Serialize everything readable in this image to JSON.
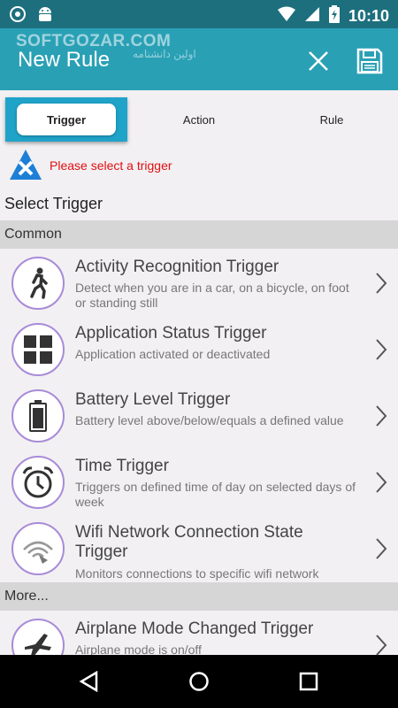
{
  "status_bar": {
    "time": "10:10"
  },
  "watermark": {
    "text": "SOFTGOZAR.COM",
    "subtext": "اولین دانشنامه"
  },
  "app_bar": {
    "title": "New Rule"
  },
  "tabs": [
    {
      "label": "Trigger"
    },
    {
      "label": "Action"
    },
    {
      "label": "Rule"
    }
  ],
  "warning": {
    "text": "Please select a trigger"
  },
  "section_title": "Select Trigger",
  "groups": {
    "common": "Common",
    "more": "More..."
  },
  "items": [
    {
      "title": "Activity Recognition Trigger",
      "desc": "Detect when you are in a car, on a bicycle, on foot or standing still",
      "icon": "walking-person-icon"
    },
    {
      "title": "Application Status Trigger",
      "desc": "Application activated or deactivated",
      "icon": "app-grid-icon"
    },
    {
      "title": "Battery Level Trigger",
      "desc": "Battery level above/below/equals a defined value",
      "icon": "battery-icon"
    },
    {
      "title": "Time Trigger",
      "desc": "Triggers on defined time of day on selected days of week",
      "icon": "alarm-clock-icon"
    },
    {
      "title": "Wifi Network Connection State Trigger",
      "desc": "Monitors connections to specific wifi network",
      "icon": "wifi-icon"
    },
    {
      "title": "Airplane Mode Changed Trigger",
      "desc": "Airplane mode is on/off",
      "icon": "airplane-icon"
    }
  ],
  "colors": {
    "status_bar": "#1d6f7e",
    "app_bar": "#2aa0b5",
    "active_tab": "#1fa3c9",
    "warning_text": "#e01010",
    "icon_ring": "#a88bd8"
  }
}
